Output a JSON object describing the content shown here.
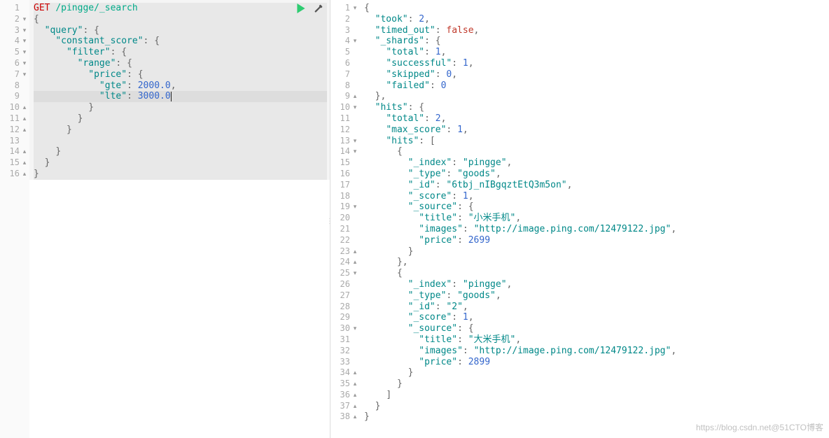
{
  "watermark": "https://blog.csdn.net@51CTO博客",
  "left": {
    "actions": {
      "play": "play-icon",
      "wrench": "wrench-icon"
    },
    "highlightStart": 1,
    "highlightEnd": 16,
    "activeLine": 9,
    "lines": [
      {
        "n": 1,
        "fold": "",
        "t": [
          [
            "method",
            "GET"
          ],
          [
            "plain",
            " "
          ],
          [
            "path",
            "/pingge/_search"
          ]
        ]
      },
      {
        "n": 2,
        "fold": "▾",
        "t": [
          [
            "punc",
            "{"
          ]
        ]
      },
      {
        "n": 3,
        "fold": "▾",
        "t": [
          [
            "plain",
            "  "
          ],
          [
            "key",
            "\"query\""
          ],
          [
            "punc",
            ": {"
          ]
        ]
      },
      {
        "n": 4,
        "fold": "▾",
        "t": [
          [
            "plain",
            "    "
          ],
          [
            "key",
            "\"constant_score\""
          ],
          [
            "punc",
            ": {"
          ]
        ]
      },
      {
        "n": 5,
        "fold": "▾",
        "t": [
          [
            "plain",
            "      "
          ],
          [
            "key",
            "\"filter\""
          ],
          [
            "punc",
            ": {"
          ]
        ]
      },
      {
        "n": 6,
        "fold": "▾",
        "t": [
          [
            "plain",
            "        "
          ],
          [
            "key",
            "\"range\""
          ],
          [
            "punc",
            ": {"
          ]
        ]
      },
      {
        "n": 7,
        "fold": "▾",
        "t": [
          [
            "plain",
            "          "
          ],
          [
            "key",
            "\"price\""
          ],
          [
            "punc",
            ": {"
          ]
        ]
      },
      {
        "n": 8,
        "fold": "",
        "t": [
          [
            "plain",
            "            "
          ],
          [
            "key",
            "\"gte\""
          ],
          [
            "punc",
            ": "
          ],
          [
            "num",
            "2000.0"
          ],
          [
            "punc",
            ","
          ]
        ]
      },
      {
        "n": 9,
        "fold": "",
        "t": [
          [
            "plain",
            "            "
          ],
          [
            "key",
            "\"lte\""
          ],
          [
            "punc",
            ": "
          ],
          [
            "num",
            "3000.0"
          ],
          [
            "cursor",
            ""
          ]
        ]
      },
      {
        "n": 10,
        "fold": "▴",
        "t": [
          [
            "plain",
            "          "
          ],
          [
            "punc",
            "}"
          ]
        ]
      },
      {
        "n": 11,
        "fold": "▴",
        "t": [
          [
            "plain",
            "        "
          ],
          [
            "punc",
            "}"
          ]
        ]
      },
      {
        "n": 12,
        "fold": "▴",
        "t": [
          [
            "plain",
            "      "
          ],
          [
            "punc",
            "}"
          ]
        ]
      },
      {
        "n": 13,
        "fold": "",
        "t": [
          [
            "plain",
            "      "
          ]
        ]
      },
      {
        "n": 14,
        "fold": "▴",
        "t": [
          [
            "plain",
            "    "
          ],
          [
            "punc",
            "}"
          ]
        ]
      },
      {
        "n": 15,
        "fold": "▴",
        "t": [
          [
            "plain",
            "  "
          ],
          [
            "punc",
            "}"
          ]
        ]
      },
      {
        "n": 16,
        "fold": "▴",
        "t": [
          [
            "punc",
            "}"
          ]
        ]
      }
    ]
  },
  "right": {
    "lines": [
      {
        "n": 1,
        "fold": "▾",
        "t": [
          [
            "punc",
            "{"
          ]
        ]
      },
      {
        "n": 2,
        "fold": "",
        "t": [
          [
            "plain",
            "  "
          ],
          [
            "key",
            "\"took\""
          ],
          [
            "punc",
            ": "
          ],
          [
            "num",
            "2"
          ],
          [
            "punc",
            ","
          ]
        ]
      },
      {
        "n": 3,
        "fold": "",
        "t": [
          [
            "plain",
            "  "
          ],
          [
            "key",
            "\"timed_out\""
          ],
          [
            "punc",
            ": "
          ],
          [
            "bool",
            "false"
          ],
          [
            "punc",
            ","
          ]
        ]
      },
      {
        "n": 4,
        "fold": "▾",
        "t": [
          [
            "plain",
            "  "
          ],
          [
            "key",
            "\"_shards\""
          ],
          [
            "punc",
            ": {"
          ]
        ]
      },
      {
        "n": 5,
        "fold": "",
        "t": [
          [
            "plain",
            "    "
          ],
          [
            "key",
            "\"total\""
          ],
          [
            "punc",
            ": "
          ],
          [
            "num",
            "1"
          ],
          [
            "punc",
            ","
          ]
        ]
      },
      {
        "n": 6,
        "fold": "",
        "t": [
          [
            "plain",
            "    "
          ],
          [
            "key",
            "\"successful\""
          ],
          [
            "punc",
            ": "
          ],
          [
            "num",
            "1"
          ],
          [
            "punc",
            ","
          ]
        ]
      },
      {
        "n": 7,
        "fold": "",
        "t": [
          [
            "plain",
            "    "
          ],
          [
            "key",
            "\"skipped\""
          ],
          [
            "punc",
            ": "
          ],
          [
            "num",
            "0"
          ],
          [
            "punc",
            ","
          ]
        ]
      },
      {
        "n": 8,
        "fold": "",
        "t": [
          [
            "plain",
            "    "
          ],
          [
            "key",
            "\"failed\""
          ],
          [
            "punc",
            ": "
          ],
          [
            "num",
            "0"
          ]
        ]
      },
      {
        "n": 9,
        "fold": "▴",
        "t": [
          [
            "plain",
            "  "
          ],
          [
            "punc",
            "},"
          ]
        ]
      },
      {
        "n": 10,
        "fold": "▾",
        "t": [
          [
            "plain",
            "  "
          ],
          [
            "key",
            "\"hits\""
          ],
          [
            "punc",
            ": {"
          ]
        ]
      },
      {
        "n": 11,
        "fold": "",
        "t": [
          [
            "plain",
            "    "
          ],
          [
            "key",
            "\"total\""
          ],
          [
            "punc",
            ": "
          ],
          [
            "num",
            "2"
          ],
          [
            "punc",
            ","
          ]
        ]
      },
      {
        "n": 12,
        "fold": "",
        "t": [
          [
            "plain",
            "    "
          ],
          [
            "key",
            "\"max_score\""
          ],
          [
            "punc",
            ": "
          ],
          [
            "num",
            "1"
          ],
          [
            "punc",
            ","
          ]
        ]
      },
      {
        "n": 13,
        "fold": "▾",
        "t": [
          [
            "plain",
            "    "
          ],
          [
            "key",
            "\"hits\""
          ],
          [
            "punc",
            ": ["
          ]
        ]
      },
      {
        "n": 14,
        "fold": "▾",
        "t": [
          [
            "plain",
            "      "
          ],
          [
            "punc",
            "{"
          ]
        ]
      },
      {
        "n": 15,
        "fold": "",
        "t": [
          [
            "plain",
            "        "
          ],
          [
            "key",
            "\"_index\""
          ],
          [
            "punc",
            ": "
          ],
          [
            "str",
            "\"pingge\""
          ],
          [
            "punc",
            ","
          ]
        ]
      },
      {
        "n": 16,
        "fold": "",
        "t": [
          [
            "plain",
            "        "
          ],
          [
            "key",
            "\"_type\""
          ],
          [
            "punc",
            ": "
          ],
          [
            "str",
            "\"goods\""
          ],
          [
            "punc",
            ","
          ]
        ]
      },
      {
        "n": 17,
        "fold": "",
        "t": [
          [
            "plain",
            "        "
          ],
          [
            "key",
            "\"_id\""
          ],
          [
            "punc",
            ": "
          ],
          [
            "str",
            "\"6tbj_nIBgqztEtQ3m5on\""
          ],
          [
            "punc",
            ","
          ]
        ]
      },
      {
        "n": 18,
        "fold": "",
        "t": [
          [
            "plain",
            "        "
          ],
          [
            "key",
            "\"_score\""
          ],
          [
            "punc",
            ": "
          ],
          [
            "num",
            "1"
          ],
          [
            "punc",
            ","
          ]
        ]
      },
      {
        "n": 19,
        "fold": "▾",
        "t": [
          [
            "plain",
            "        "
          ],
          [
            "key",
            "\"_source\""
          ],
          [
            "punc",
            ": {"
          ]
        ]
      },
      {
        "n": 20,
        "fold": "",
        "t": [
          [
            "plain",
            "          "
          ],
          [
            "key",
            "\"title\""
          ],
          [
            "punc",
            ": "
          ],
          [
            "str",
            "\"小米手机\""
          ],
          [
            "punc",
            ","
          ]
        ]
      },
      {
        "n": 21,
        "fold": "",
        "t": [
          [
            "plain",
            "          "
          ],
          [
            "key",
            "\"images\""
          ],
          [
            "punc",
            ": "
          ],
          [
            "str",
            "\"http://image.ping.com/12479122.jpg\""
          ],
          [
            "punc",
            ","
          ]
        ]
      },
      {
        "n": 22,
        "fold": "",
        "t": [
          [
            "plain",
            "          "
          ],
          [
            "key",
            "\"price\""
          ],
          [
            "punc",
            ": "
          ],
          [
            "num",
            "2699"
          ]
        ]
      },
      {
        "n": 23,
        "fold": "▴",
        "t": [
          [
            "plain",
            "        "
          ],
          [
            "punc",
            "}"
          ]
        ]
      },
      {
        "n": 24,
        "fold": "▴",
        "t": [
          [
            "plain",
            "      "
          ],
          [
            "punc",
            "},"
          ]
        ]
      },
      {
        "n": 25,
        "fold": "▾",
        "t": [
          [
            "plain",
            "      "
          ],
          [
            "punc",
            "{"
          ]
        ]
      },
      {
        "n": 26,
        "fold": "",
        "t": [
          [
            "plain",
            "        "
          ],
          [
            "key",
            "\"_index\""
          ],
          [
            "punc",
            ": "
          ],
          [
            "str",
            "\"pingge\""
          ],
          [
            "punc",
            ","
          ]
        ]
      },
      {
        "n": 27,
        "fold": "",
        "t": [
          [
            "plain",
            "        "
          ],
          [
            "key",
            "\"_type\""
          ],
          [
            "punc",
            ": "
          ],
          [
            "str",
            "\"goods\""
          ],
          [
            "punc",
            ","
          ]
        ]
      },
      {
        "n": 28,
        "fold": "",
        "t": [
          [
            "plain",
            "        "
          ],
          [
            "key",
            "\"_id\""
          ],
          [
            "punc",
            ": "
          ],
          [
            "str",
            "\"2\""
          ],
          [
            "punc",
            ","
          ]
        ]
      },
      {
        "n": 29,
        "fold": "",
        "t": [
          [
            "plain",
            "        "
          ],
          [
            "key",
            "\"_score\""
          ],
          [
            "punc",
            ": "
          ],
          [
            "num",
            "1"
          ],
          [
            "punc",
            ","
          ]
        ]
      },
      {
        "n": 30,
        "fold": "▾",
        "t": [
          [
            "plain",
            "        "
          ],
          [
            "key",
            "\"_source\""
          ],
          [
            "punc",
            ": {"
          ]
        ]
      },
      {
        "n": 31,
        "fold": "",
        "t": [
          [
            "plain",
            "          "
          ],
          [
            "key",
            "\"title\""
          ],
          [
            "punc",
            ": "
          ],
          [
            "str",
            "\"大米手机\""
          ],
          [
            "punc",
            ","
          ]
        ]
      },
      {
        "n": 32,
        "fold": "",
        "t": [
          [
            "plain",
            "          "
          ],
          [
            "key",
            "\"images\""
          ],
          [
            "punc",
            ": "
          ],
          [
            "str",
            "\"http://image.ping.com/12479122.jpg\""
          ],
          [
            "punc",
            ","
          ]
        ]
      },
      {
        "n": 33,
        "fold": "",
        "t": [
          [
            "plain",
            "          "
          ],
          [
            "key",
            "\"price\""
          ],
          [
            "punc",
            ": "
          ],
          [
            "num",
            "2899"
          ]
        ]
      },
      {
        "n": 34,
        "fold": "▴",
        "t": [
          [
            "plain",
            "        "
          ],
          [
            "punc",
            "}"
          ]
        ]
      },
      {
        "n": 35,
        "fold": "▴",
        "t": [
          [
            "plain",
            "      "
          ],
          [
            "punc",
            "}"
          ]
        ]
      },
      {
        "n": 36,
        "fold": "▴",
        "t": [
          [
            "plain",
            "    "
          ],
          [
            "punc",
            "]"
          ]
        ]
      },
      {
        "n": 37,
        "fold": "▴",
        "t": [
          [
            "plain",
            "  "
          ],
          [
            "punc",
            "}"
          ]
        ]
      },
      {
        "n": 38,
        "fold": "▴",
        "t": [
          [
            "punc",
            "}"
          ]
        ]
      }
    ]
  }
}
